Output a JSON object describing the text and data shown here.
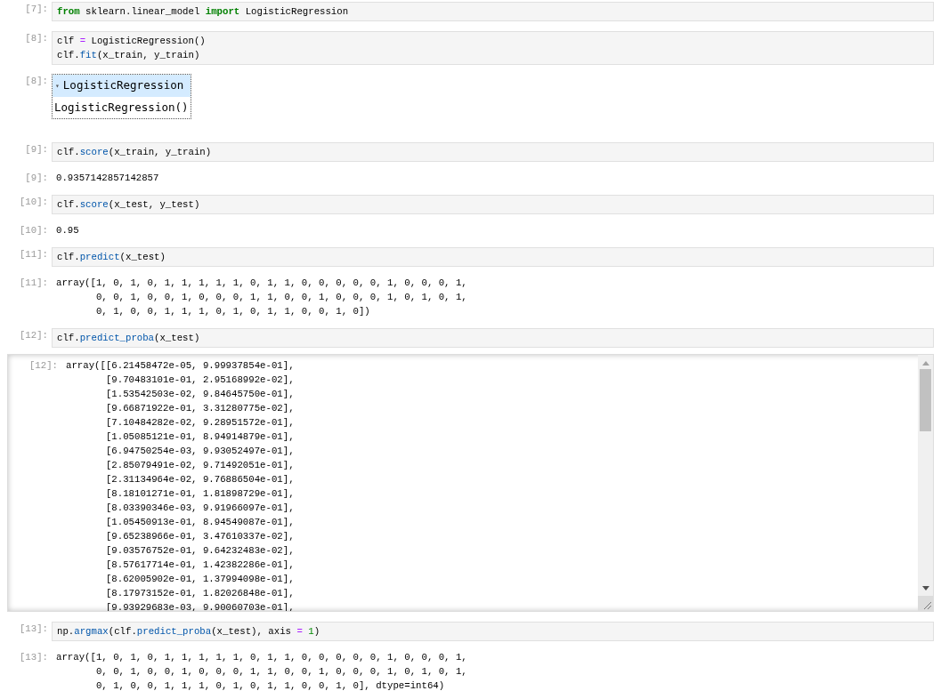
{
  "cells": [
    {
      "prompt": "[7]:",
      "code": [
        [
          {
            "kind": "keyword",
            "text": "from"
          },
          {
            "kind": "plain",
            "text": " sklearn.linear_model "
          },
          {
            "kind": "keyword",
            "text": "import"
          },
          {
            "kind": "plain",
            "text": " LogisticRegression"
          }
        ]
      ]
    },
    {
      "prompt": "[8]:",
      "code": [
        [
          {
            "kind": "plain",
            "text": "clf "
          },
          {
            "kind": "operator",
            "text": "="
          },
          {
            "kind": "plain",
            "text": " LogisticRegression()"
          }
        ],
        [
          {
            "kind": "plain",
            "text": "clf."
          },
          {
            "kind": "func",
            "text": "fit"
          },
          {
            "kind": "plain",
            "text": "(x_train, y_train)"
          }
        ]
      ],
      "output": {
        "kind": "estimator",
        "prompt": "[8]:",
        "caret": "▾",
        "label": "LogisticRegression",
        "repr": "LogisticRegression()"
      }
    },
    {
      "prompt": "[9]:",
      "code": [
        [
          {
            "kind": "plain",
            "text": "clf."
          },
          {
            "kind": "func",
            "text": "score"
          },
          {
            "kind": "plain",
            "text": "(x_train, y_train)"
          }
        ]
      ],
      "output": {
        "kind": "text",
        "prompt": "[9]:",
        "lines": [
          "0.9357142857142857"
        ]
      }
    },
    {
      "prompt": "[10]:",
      "code": [
        [
          {
            "kind": "plain",
            "text": "clf."
          },
          {
            "kind": "func",
            "text": "score"
          },
          {
            "kind": "plain",
            "text": "(x_test, y_test)"
          }
        ]
      ],
      "output": {
        "kind": "text",
        "prompt": "[10]:",
        "lines": [
          "0.95"
        ]
      }
    },
    {
      "prompt": "[11]:",
      "code": [
        [
          {
            "kind": "plain",
            "text": "clf."
          },
          {
            "kind": "func",
            "text": "predict"
          },
          {
            "kind": "plain",
            "text": "(x_test)"
          }
        ]
      ],
      "output": {
        "kind": "text",
        "prompt": "[11]:",
        "lines": [
          "array([1, 0, 1, 0, 1, 1, 1, 1, 1, 0, 1, 1, 0, 0, 0, 0, 0, 1, 0, 0, 0, 1,",
          "       0, 0, 1, 0, 0, 1, 0, 0, 0, 1, 1, 0, 0, 1, 0, 0, 0, 1, 0, 1, 0, 1,",
          "       0, 1, 0, 0, 1, 1, 1, 0, 1, 0, 1, 1, 0, 0, 1, 0])"
        ]
      }
    },
    {
      "prompt": "[12]:",
      "code": [
        [
          {
            "kind": "plain",
            "text": "clf."
          },
          {
            "kind": "func",
            "text": "predict_proba"
          },
          {
            "kind": "plain",
            "text": "(x_test)"
          }
        ]
      ],
      "output": {
        "kind": "scrolled",
        "prompt": "[12]:",
        "lines": [
          "array([[6.21458472e-05, 9.99937854e-01],",
          "       [9.70483101e-01, 2.95168992e-02],",
          "       [1.53542503e-02, 9.84645750e-01],",
          "       [9.66871922e-01, 3.31280775e-02],",
          "       [7.10484282e-02, 9.28951572e-01],",
          "       [1.05085121e-01, 8.94914879e-01],",
          "       [6.94750254e-03, 9.93052497e-01],",
          "       [2.85079491e-02, 9.71492051e-01],",
          "       [2.31134964e-02, 9.76886504e-01],",
          "       [8.18101271e-01, 1.81898729e-01],",
          "       [8.03390346e-03, 9.91966097e-01],",
          "       [1.05450913e-01, 8.94549087e-01],",
          "       [9.65238966e-01, 3.47610337e-02],",
          "       [9.03576752e-01, 9.64232483e-02],",
          "       [8.57617714e-01, 1.42382286e-01],",
          "       [8.62005902e-01, 1.37994098e-01],",
          "       [8.17973152e-01, 1.82026848e-01],",
          "       [9.93929683e-03, 9.90060703e-01],"
        ]
      }
    },
    {
      "prompt": "[13]:",
      "code": [
        [
          {
            "kind": "plain",
            "text": "np."
          },
          {
            "kind": "func",
            "text": "argmax"
          },
          {
            "kind": "plain",
            "text": "(clf."
          },
          {
            "kind": "func",
            "text": "predict_proba"
          },
          {
            "kind": "plain",
            "text": "(x_test), axis "
          },
          {
            "kind": "operator",
            "text": "="
          },
          {
            "kind": "number",
            "text": " 1"
          },
          {
            "kind": "plain",
            "text": ")"
          }
        ]
      ],
      "output": {
        "kind": "text",
        "prompt": "[13]:",
        "lines": [
          "array([1, 0, 1, 0, 1, 1, 1, 1, 1, 0, 1, 1, 0, 0, 0, 0, 0, 1, 0, 0, 0, 1,",
          "       0, 0, 1, 0, 0, 1, 0, 0, 0, 1, 1, 0, 0, 1, 0, 0, 0, 1, 0, 1, 0, 1,",
          "       0, 1, 0, 0, 1, 1, 1, 0, 1, 0, 1, 1, 0, 0, 1, 0], dtype=int64)"
        ]
      }
    }
  ]
}
